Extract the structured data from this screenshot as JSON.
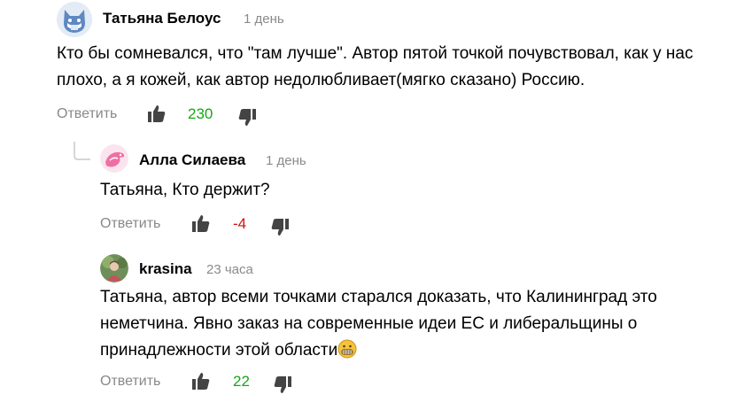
{
  "comments": [
    {
      "author": "Татьяна Белоус",
      "time": "1 день",
      "text": "Кто бы сомневался, что \"там лучше\". Автор пятой точкой почувствовал, как у нас плохо, а я кожей, как автор недолюбливает(мягко сказано) Россию.",
      "reply_label": "Ответить",
      "score": "230",
      "avatar_icon": "cat-avatar-icon"
    },
    {
      "author": "Алла Силаева",
      "time": "1 день",
      "text": "Татьяна, Кто держит?",
      "reply_label": "Ответить",
      "score": "-4",
      "avatar_icon": "bird-avatar-icon"
    },
    {
      "author": "krasina",
      "time": "23 часа",
      "text": "Татьяна, автор всеми точками старался доказать, что Калининград это неметчина. Явно заказ на современные идеи ЕС и либеральщины о принадлежности этой области",
      "reply_label": "Ответить",
      "score": "22",
      "avatar_icon": "photo-avatar-icon",
      "emoji": "grimacing-face-emoji"
    }
  ],
  "colors": {
    "positive": "#14a814",
    "negative": "#d01010",
    "muted": "#888888"
  }
}
